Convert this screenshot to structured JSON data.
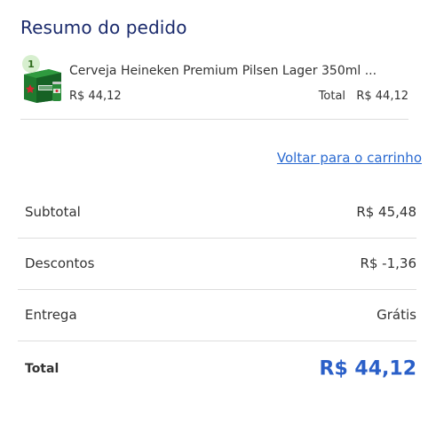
{
  "summary": {
    "title": "Resumo do pedido"
  },
  "item": {
    "quantity": "1",
    "name": "Cerveja Heineken Premium Pilsen Lager 350ml ...",
    "price": "R$ 44,12",
    "total_label": "Total",
    "total_value": "R$ 44,12",
    "image_icon": "beer-pack-image"
  },
  "links": {
    "back_to_cart": "Voltar para o carrinho"
  },
  "totals": {
    "subtotal_label": "Subtotal",
    "subtotal_value": "R$ 45,48",
    "discounts_label": "Descontos",
    "discounts_value": "R$ -1,36",
    "delivery_label": "Entrega",
    "delivery_value": "Grátis",
    "total_label": "Total",
    "total_value": "R$ 44,12"
  },
  "colors": {
    "title": "#1a2a6c",
    "link": "#2a6ad1",
    "total_value": "#2a5fc8",
    "badge_bg": "#d7efcf"
  }
}
